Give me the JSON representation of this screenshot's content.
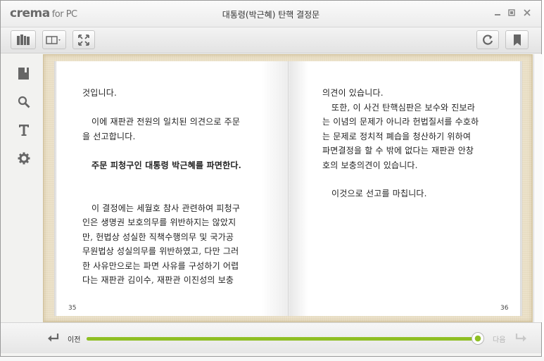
{
  "app": {
    "logo_main": "crema",
    "logo_sub": "for PC",
    "window_title": "대통령(박근혜) 탄핵 결정문"
  },
  "toolbar": {
    "icons": [
      "library-icon",
      "layout-toggle-icon",
      "fullscreen-icon",
      "sync-icon",
      "bookmark-icon"
    ]
  },
  "sidebar": {
    "icons": [
      "bookmark-list-icon",
      "search-icon",
      "text-settings-icon",
      "settings-icon"
    ]
  },
  "book": {
    "left_page": {
      "lines": [
        "것입니다.",
        "이에 재판관 전원의 일치된 의견으로 주문",
        "을 선고합니다.",
        "주문 피청구인 대통령 박근혜를 파면한다.",
        "이 결정에는 세월호 참사 관련하여 피청구",
        "인은 생명권 보호의무를 위반하지는 않았지",
        "만, 헌법상 성실한 직책수행의무 및 국가공",
        "무원법상 성실의무를 위반하였고, 다만 그러",
        "한 사유만으로는 파면 사유를 구성하기 어렵",
        "다는 재판관 김이수, 재판관 이진성의 보충"
      ],
      "page_number": "35"
    },
    "right_page": {
      "lines": [
        "의견이 있습니다.",
        "또한, 이 사건 탄핵심판은 보수와 진보라",
        "는 이념의 문제가 아니라 헌법질서를 수호하",
        "는 문제로 정치적 폐습을 청산하기 위하여",
        "파면결정을 할 수 밖에 없다는 재판관 안창",
        "호의 보충의견이 있습니다.",
        "이것으로 선고를 마칩니다."
      ],
      "page_number": "36"
    }
  },
  "navigation": {
    "prev_label": "이전",
    "next_label": "다음",
    "progress_fraction": 0.99,
    "accent_color": "#8fbf24"
  }
}
